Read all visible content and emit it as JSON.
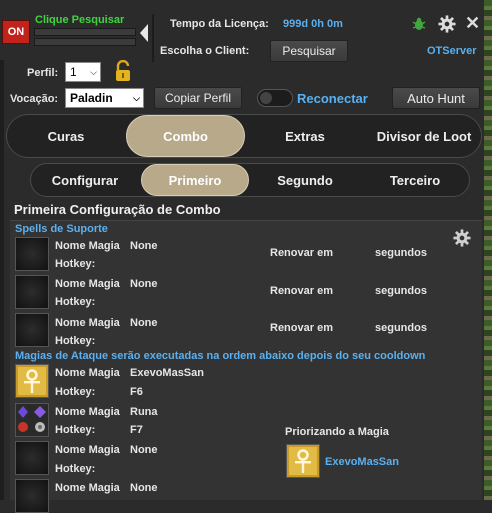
{
  "header": {
    "on_label": "ON",
    "clique_label": "Clique Pesquisar",
    "license_label": "Tempo da Licença:",
    "license_value": "999d 0h 0m",
    "escolha_label": "Escolha o Client:",
    "pesquisar_label": "Pesquisar",
    "server_label": "OTServer"
  },
  "profile": {
    "perfil_label": "Perfil:",
    "perfil_value": "1",
    "vocacao_label": "Vocação:",
    "vocacao_value": "Paladin",
    "copiar_label": "Copiar Perfil",
    "reconectar_label": "Reconectar",
    "autohunt_label": "Auto Hunt"
  },
  "main_tabs": [
    "Curas",
    "Combo",
    "Extras",
    "Divisor de Loot"
  ],
  "main_tab_active": "Combo",
  "sub_tabs": [
    "Configurar",
    "Primeiro",
    "Segundo",
    "Terceiro"
  ],
  "sub_tab_active": "Primeiro",
  "section_title": "Primeira Configuração de Combo",
  "support": {
    "heading": "Spells de Suporte",
    "rows": [
      {
        "nome_label": "Nome Magia",
        "nome_value": "None",
        "hotkey_label": "Hotkey:",
        "renovar_label": "Renovar em",
        "segundos_label": "segundos"
      },
      {
        "nome_label": "Nome Magia",
        "nome_value": "None",
        "hotkey_label": "Hotkey:",
        "renovar_label": "Renovar em",
        "segundos_label": "segundos"
      },
      {
        "nome_label": "Nome Magia",
        "nome_value": "None",
        "hotkey_label": "Hotkey:",
        "renovar_label": "Renovar em",
        "segundos_label": "segundos"
      }
    ]
  },
  "attack": {
    "heading": "Magias de Ataque serão executadas na ordem abaixo depois do seu cooldown",
    "rows": [
      {
        "nome_label": "Nome Magia",
        "nome_value": "ExevoMasSan",
        "hotkey_label": "Hotkey:",
        "hotkey_value": "F6",
        "icon": "ankh-icon"
      },
      {
        "nome_label": "Nome Magia",
        "nome_value": "Runa",
        "hotkey_label": "Hotkey:",
        "hotkey_value": "F7",
        "icon": "runes-icon"
      },
      {
        "nome_label": "Nome Magia",
        "nome_value": "None",
        "hotkey_label": "Hotkey:",
        "hotkey_value": "",
        "icon": "empty-slot"
      },
      {
        "nome_label": "Nome Magia",
        "nome_value": "None",
        "hotkey_label": "",
        "hotkey_value": "",
        "icon": "empty-slot"
      }
    ],
    "priority_label": "Priorizando a Magia",
    "priority_spell": "ExevoMasSan"
  },
  "colors": {
    "accent_blue": "#5ab0f0",
    "on_red": "#c1221c",
    "status_green": "#3ed53e",
    "tab_active": "#b7a98a"
  }
}
